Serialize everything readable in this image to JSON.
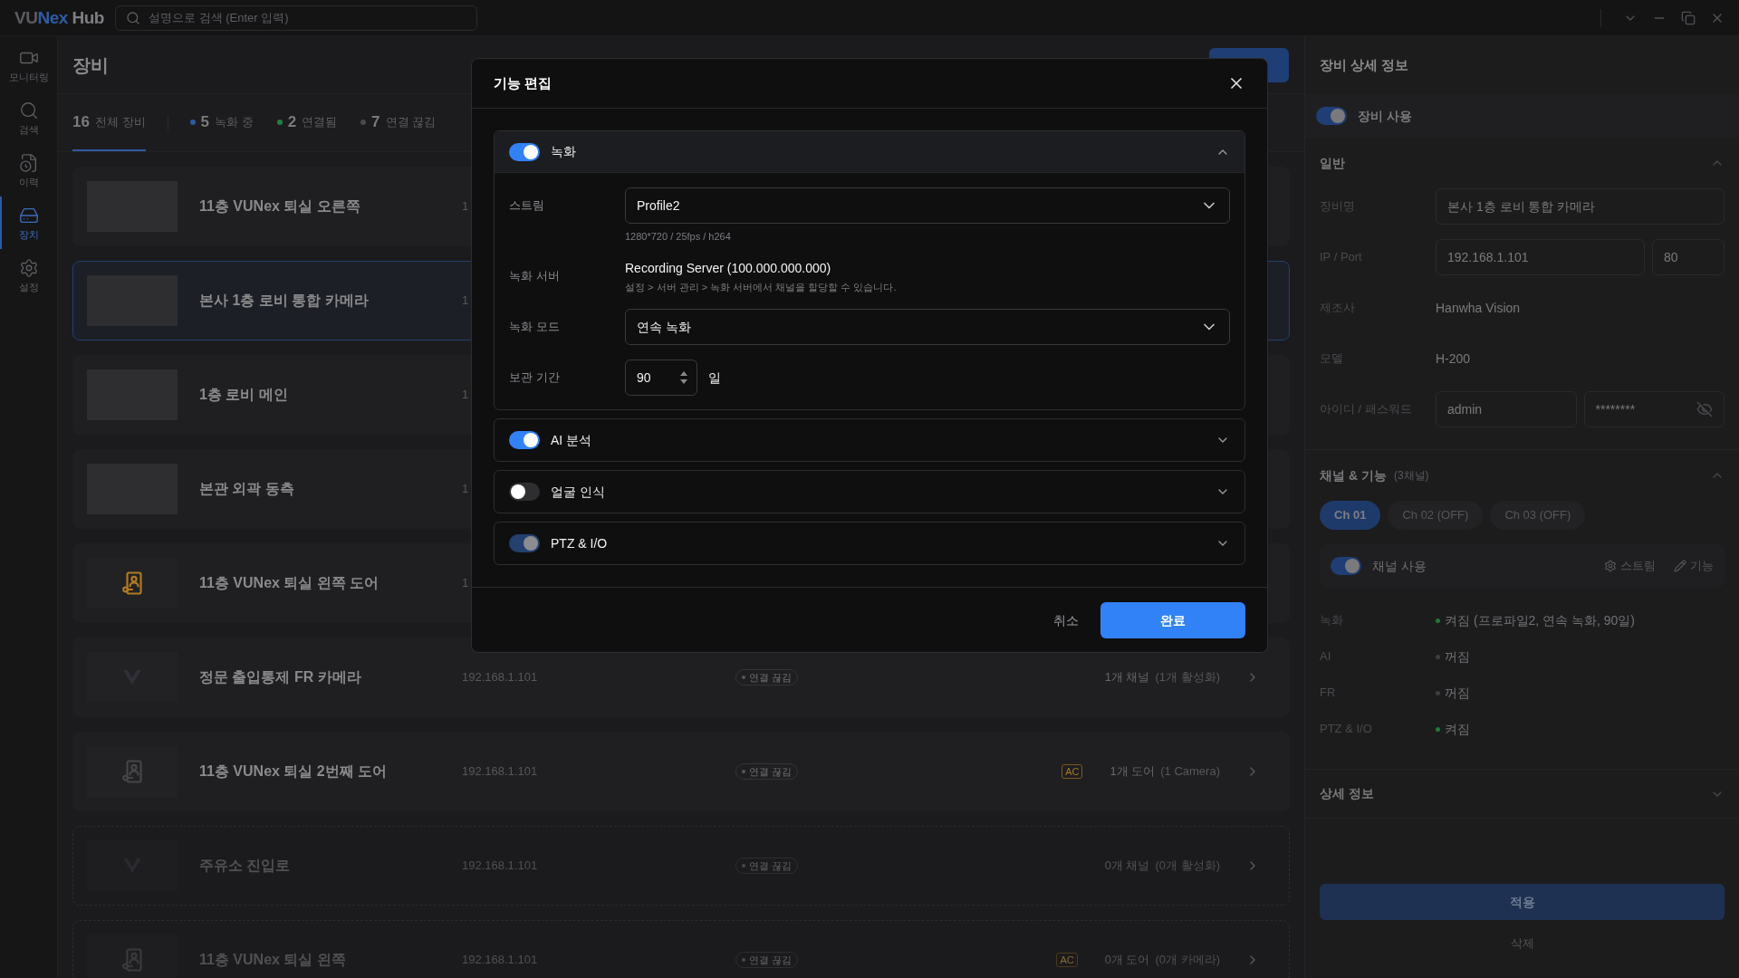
{
  "titlebar": {
    "logo": {
      "lead": "VU",
      "accent": "Nex",
      "tail": "Hub"
    },
    "search": {
      "placeholder": "설명으로 검색 (Enter 입력)"
    }
  },
  "nav": [
    {
      "label": "모니터링",
      "kind": "camera",
      "selected": false
    },
    {
      "label": "검색",
      "kind": "search",
      "selected": false
    },
    {
      "label": "이력",
      "kind": "history",
      "selected": false
    },
    {
      "label": "장치",
      "kind": "device",
      "selected": true
    },
    {
      "label": "설정",
      "kind": "settings",
      "selected": false
    }
  ],
  "page": {
    "title": "장비",
    "filters": [
      {
        "count": "16",
        "label": "전체 장비",
        "selected": true
      },
      {
        "count": "5",
        "label": "녹화 중",
        "color": "#2d5aa0",
        "selected": false
      },
      {
        "count": "2",
        "label": "연결됨",
        "color": "#23803f",
        "selected": false
      },
      {
        "count": "7",
        "label": "연결 끊김",
        "color": "#4a4a4e",
        "selected": false
      }
    ]
  },
  "devices": [
    {
      "name": "11층 VUNex 퇴실 오른쪽",
      "ip": "1",
      "thumbnail": {
        "kind": "photo"
      },
      "selected": false,
      "disabled": false
    },
    {
      "name": "본사 1층 로비 통합 카메라",
      "ip": "1",
      "thumbnail": {
        "kind": "photo"
      },
      "selected": true,
      "disabled": false
    },
    {
      "name": "1층 로비 메인",
      "ip": "1",
      "thumbnail": {
        "kind": "photo"
      },
      "selected": false,
      "disabled": false
    },
    {
      "name": "본관 외곽 동측",
      "ip": "1",
      "thumbnail": {
        "kind": "photo"
      },
      "selected": false,
      "disabled": false
    },
    {
      "name": "11층 VUNex 퇴실 왼쪽 도어",
      "ip": "1",
      "thumbnail": {
        "kind": "door",
        "color": "#b07a20"
      },
      "selected": false,
      "disabled": false
    },
    {
      "name": "정문 출입통제 FR 카메라",
      "ip": "192.168.1.101",
      "thumbnail": {
        "kind": "logo"
      },
      "status": "연결 끊김",
      "summary": "1개 채널",
      "summary_detail": "(1개 활성화)",
      "selected": false,
      "disabled": false
    },
    {
      "name": "11층 VUNex 퇴실 2번째 도어",
      "ip": "192.168.1.101",
      "thumbnail": {
        "kind": "door",
        "color": "#45454a"
      },
      "status": "연결 끊김",
      "tag": "AC",
      "summary": "1개 도어",
      "summary_detail": "(1 Camera)",
      "selected": false,
      "disabled": false
    },
    {
      "name": "주유소 진입로",
      "ip": "192.168.1.101",
      "thumbnail": {
        "kind": "logo"
      },
      "status": "연결 끊김",
      "summary": "0개 채널",
      "summary_detail": "(0개 활성화)",
      "selected": false,
      "disabled": true
    },
    {
      "name": "11층 VUNex 퇴실 왼쪽",
      "ip": "192.168.1.101",
      "thumbnail": {
        "kind": "door",
        "color": "#3a3a3e"
      },
      "status": "연결 끊김",
      "tag": "AC",
      "summary": "0개 도어",
      "summary_detail": "(0개 카메라)",
      "selected": false,
      "disabled": true
    }
  ],
  "details": {
    "title": "장비 상세 정보",
    "enabled": {
      "label": "장비 사용",
      "on": true
    },
    "general": {
      "title": "일반",
      "expanded": true,
      "fields": [
        {
          "label": "장비명",
          "kind": "input",
          "value": "본사 1층 로비 통합 카메라"
        },
        {
          "label": "IP / Port",
          "kind": "input_pair",
          "values": [
            "192.168.1.101",
            "80"
          ]
        },
        {
          "label": "제조사",
          "kind": "text",
          "value": "Hanwha Vision"
        },
        {
          "label": "모델",
          "kind": "text",
          "value": "H-200"
        },
        {
          "label": "아이디 / 패스워드",
          "kind": "credentials",
          "values": [
            "admin",
            "********"
          ]
        }
      ]
    },
    "channels": {
      "title": "채널 & 기능",
      "count": "(3채널)",
      "expanded": true,
      "tabs": [
        {
          "label": "Ch 01",
          "selected": true
        },
        {
          "label": "Ch 02 (OFF)",
          "selected": false
        },
        {
          "label": "Ch 03 (OFF)",
          "selected": false
        }
      ],
      "channel_toggle": {
        "label": "채널 사용",
        "on": true
      },
      "actions": [
        {
          "label": "스트림",
          "kind": "settings"
        },
        {
          "label": "기능",
          "kind": "edit"
        }
      ],
      "features": [
        {
          "label": "녹화",
          "value": "켜짐 (프로파일2, 연속 녹화, 90일)",
          "on": true
        },
        {
          "label": "AI",
          "value": "꺼짐",
          "on": false
        },
        {
          "label": "FR",
          "value": "꺼짐",
          "on": false
        },
        {
          "label": "PTZ & I/O",
          "value": "켜짐",
          "on": true
        }
      ]
    },
    "more": {
      "title": "상세 정보",
      "expanded": false
    },
    "apply": "적용",
    "delete": "삭제"
  },
  "dialog": {
    "title": "기능 편집",
    "sections": [
      {
        "label": "녹화",
        "on": true,
        "disabled": false,
        "expanded": true,
        "fields": [
          {
            "label": "스트림",
            "kind": "select",
            "value": "Profile2",
            "hint": "1280*720 / 25fps / h264"
          },
          {
            "label": "녹화 서버",
            "kind": "text",
            "value": "Recording Server (100.000.000.000)",
            "hint": "설정 > 서버 관리 > 녹화 서버에서 채널을 할당할 수 있습니다."
          },
          {
            "label": "녹화 모드",
            "kind": "select",
            "value": "연속 녹화"
          },
          {
            "label": "보관 기간",
            "kind": "number",
            "value": "90",
            "unit": "일"
          }
        ]
      },
      {
        "label": "AI 분석",
        "on": true,
        "disabled": false,
        "expanded": false
      },
      {
        "label": "얼굴 인식",
        "on": false,
        "disabled": false,
        "expanded": false
      },
      {
        "label": "PTZ & I/O",
        "on": true,
        "disabled": true,
        "expanded": false
      }
    ],
    "cancel": "취소",
    "confirm": "완료"
  }
}
